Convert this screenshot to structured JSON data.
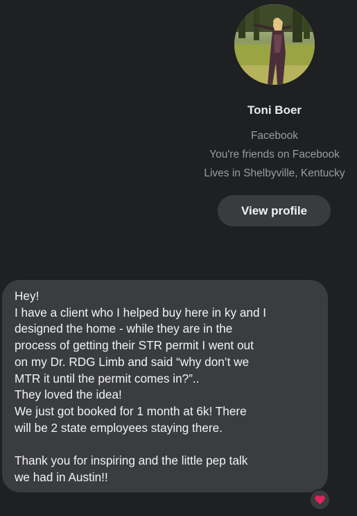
{
  "contact": {
    "name": "Toni Boer",
    "source": "Facebook",
    "friendship": "You're friends on Facebook",
    "location": "Lives in Shelbyville, Kentucky",
    "view_profile_label": "View profile",
    "avatar_icon": "profile-photo"
  },
  "message": {
    "lines": [
      "Hey!",
      "I have a client who I helped buy here in ky and I",
      "designed the home - while they are in the",
      "process of getting their STR permit I went out",
      "on my Dr. RDG Limb and said “why don’t we",
      "MTR it until the permit comes in?”..",
      "They loved the idea!",
      "We just got booked for 1 month at 6k!  There",
      "will be 2 state employees staying there.",
      "",
      "Thank you for inspiring and the little pep talk",
      "we had in Austin!!"
    ],
    "reaction_icon": "heart-icon",
    "reaction_color": "#e0245e"
  },
  "colors": {
    "background": "#1f2022",
    "bubble": "#3b3c3f",
    "button": "#3a3b3e",
    "secondary_text": "#9a9ca1"
  }
}
